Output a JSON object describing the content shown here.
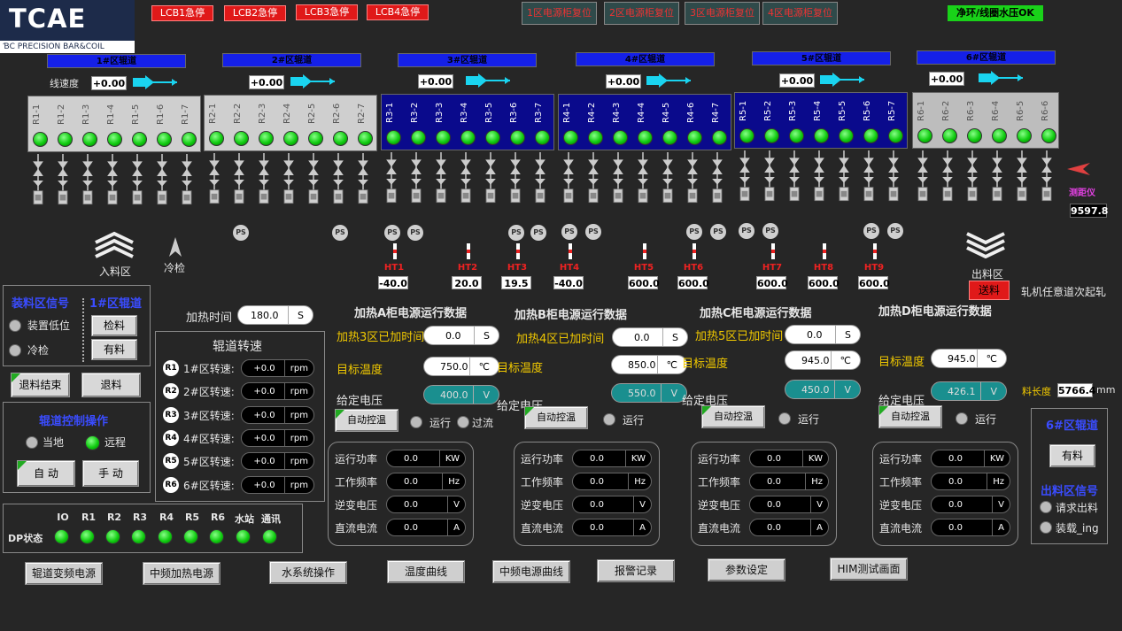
{
  "logo": {
    "brand": "TCAE",
    "sub": "PRECISION BAR&COIL"
  },
  "top": {
    "lcb": [
      "LCB1急停",
      "LCB2急停",
      "LCB3急停",
      "LCB4急停"
    ],
    "resets": [
      "1区电源柜复位",
      "2区电源柜复位",
      "3区电源柜复位",
      "4区电源柜复位"
    ],
    "water_ok": "净环/线圈水压OK"
  },
  "zones": [
    {
      "label": "1#区辊道",
      "speed": "+0.00",
      "rollers": [
        "R1-1",
        "R1-2",
        "R1-3",
        "R1-4",
        "R1-5",
        "R1-6",
        "R1-7"
      ]
    },
    {
      "label": "2#区辊道",
      "speed": "+0.00",
      "rollers": [
        "R2-1",
        "R2-2",
        "R2-3",
        "R2-4",
        "R2-5",
        "R2-6",
        "R2-7"
      ]
    },
    {
      "label": "3#区辊道",
      "speed": "+0.00",
      "rollers": [
        "R3-1",
        "R3-2",
        "R3-3",
        "R3-4",
        "R3-5",
        "R3-6",
        "R3-7"
      ]
    },
    {
      "label": "4#区辊道",
      "speed": "+0.00",
      "rollers": [
        "R4-1",
        "R4-2",
        "R4-3",
        "R4-4",
        "R4-5",
        "R4-6",
        "R4-7"
      ]
    },
    {
      "label": "5#区辊道",
      "speed": "+0.00",
      "rollers": [
        "R5-1",
        "R5-2",
        "R5-3",
        "R5-4",
        "R5-5",
        "R5-6",
        "R5-7"
      ]
    },
    {
      "label": "6#区辊道",
      "speed": "+0.00",
      "rollers": [
        "R6-1",
        "R6-2",
        "R6-3",
        "R6-4",
        "R6-5",
        "R6-6"
      ]
    }
  ],
  "line_speed_label": "线速度",
  "ps_label": "PS",
  "heaters": [
    {
      "name": "HT1",
      "value": "-40.0"
    },
    {
      "name": "HT2",
      "value": "20.0"
    },
    {
      "name": "HT3",
      "value": "19.5"
    },
    {
      "name": "HT4",
      "value": "-40.0"
    },
    {
      "name": "HT5",
      "value": "600.0"
    },
    {
      "name": "HT6",
      "value": "600.0"
    },
    {
      "name": "HT7",
      "value": "600.0"
    },
    {
      "name": "HT8",
      "value": "600.0"
    },
    {
      "name": "HT9",
      "value": "600.0"
    }
  ],
  "rangefinder": {
    "label": "测距仪",
    "value": "9597.8"
  },
  "entry_label": "入料区",
  "cold_check": "冷检",
  "exit_label": "出料区",
  "send_btn": "送料",
  "any_pass": "轧机任意道次起轧",
  "heat_time": {
    "label": "加热时间",
    "value": "180.0",
    "unit": "S"
  },
  "loading": {
    "title": "装料区信号",
    "zone1": "1#区辊道",
    "device_low": "装置低位",
    "cold_check": "冷检",
    "inspect": "检料",
    "has_material": "有料",
    "retreat_end": "退料结束",
    "retreat": "退料"
  },
  "roller_speed": {
    "title": "辊道转速",
    "items": [
      {
        "n": "R1",
        "label": "1#区转速:",
        "value": "+0.0",
        "unit": "rpm"
      },
      {
        "n": "R2",
        "label": "2#区转速:",
        "value": "+0.0",
        "unit": "rpm"
      },
      {
        "n": "R3",
        "label": "3#区转速:",
        "value": "+0.0",
        "unit": "rpm"
      },
      {
        "n": "R4",
        "label": "4#区转速:",
        "value": "+0.0",
        "unit": "rpm"
      },
      {
        "n": "R5",
        "label": "5#区转速:",
        "value": "+0.0",
        "unit": "rpm"
      },
      {
        "n": "R6",
        "label": "6#区转速:",
        "value": "+0.0",
        "unit": "rpm"
      }
    ]
  },
  "control": {
    "title": "辊道控制操作",
    "local": "当地",
    "remote": "远程",
    "auto": "自 动",
    "manual": "手 动"
  },
  "dp": {
    "label": "DP状态",
    "items": [
      "IO",
      "R1",
      "R2",
      "R3",
      "R4",
      "R5",
      "R6",
      "水站",
      "通讯"
    ]
  },
  "cabinets": [
    {
      "title": "加热A柜电源运行数据",
      "heat_label": "加热3区已加时间",
      "heat_val": "0.0",
      "heat_unit": "S",
      "target_label": "目标温度",
      "target": "750.0",
      "target_unit": "℃",
      "volt_label": "给定电压",
      "volt": "400.0",
      "volt_unit": "V",
      "auto": "自动控温",
      "run": "运行",
      "over": "过流"
    },
    {
      "title": "加热B柜电源运行数据",
      "heat_label": "加热4区已加时间",
      "heat_val": "0.0",
      "heat_unit": "S",
      "target_label": "目标温度",
      "target": "850.0",
      "target_unit": "℃",
      "volt_label": "给定电压",
      "volt": "550.0",
      "volt_unit": "V",
      "auto": "自动控温",
      "run": "运行"
    },
    {
      "title": "加热C柜电源运行数据",
      "heat_label": "加热5区已加时间",
      "heat_val": "0.0",
      "heat_unit": "S",
      "target_label": "目标温度",
      "target": "945.0",
      "target_unit": "℃",
      "volt_label": "给定电压",
      "volt": "450.0",
      "volt_unit": "V",
      "auto": "自动控温",
      "run": "运行"
    },
    {
      "title": "加热D柜电源运行数据",
      "heat_label": "",
      "heat_val": "",
      "heat_unit": "",
      "target_label": "目标温度",
      "target": "945.0",
      "target_unit": "℃",
      "volt_label": "给定电压",
      "volt": "426.1",
      "volt_unit": "V",
      "auto": "自动控温",
      "run": "运行"
    }
  ],
  "run_data_labels": [
    "运行功率",
    "工作频率",
    "逆变电压",
    "直流电流"
  ],
  "run_data_units": [
    "KW",
    "Hz",
    "V",
    "A"
  ],
  "run_data_values": [
    "0.0",
    "0.0",
    "0.0",
    "0.0"
  ],
  "material_length": {
    "label": "料长度",
    "value": "5766.4",
    "unit": "mm"
  },
  "zone6": {
    "title": "6#区辊道",
    "has": "有料",
    "signal": "出料区信号",
    "request": "请求出料",
    "loading": "装载_ing"
  },
  "nav": [
    "辊道变频电源",
    "中频加热电源",
    "水系统操作",
    "温度曲线",
    "中频电源曲线",
    "报警记录",
    "参数设定",
    "HIM测试画面"
  ]
}
